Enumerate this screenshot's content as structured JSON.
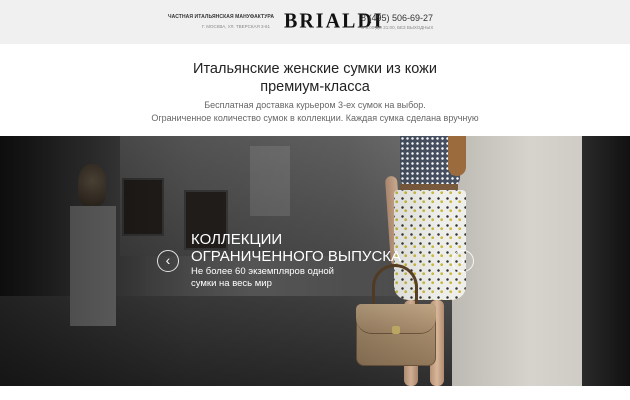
{
  "header": {
    "manufacture": "ЧАСТНАЯ ИТАЛЬЯНСКАЯ МАНУФАКТУРА",
    "address": "Г. МОСКВА, УЛ. ТВЕРСКАЯ 3-61",
    "logo": "BRIALDI",
    "phone": "8 (495) 506-69-27",
    "hours": "С 9:00 ДО 21:00, БЕЗ ВЫХОДНЫХ"
  },
  "intro": {
    "title_line1": "Итальянские женские сумки из кожи",
    "title_line2": "премиум-класса",
    "sub_line1": "Бесплатная доставка курьером 3-ех сумок на выбор.",
    "sub_line2": "Ограниченное количество сумок в коллекции. Каждая сумка сделана вручную"
  },
  "slider": {
    "title_line1": "Коллекции",
    "title_line2": "ограниченного выпуска",
    "text_line1": "Не более 60 экземпляров одной",
    "text_line2": "сумки на весь мир",
    "prev_icon": "chevron-left-icon",
    "next_icon": "chevron-right-icon",
    "prev_glyph": "‹",
    "next_glyph": "›"
  }
}
